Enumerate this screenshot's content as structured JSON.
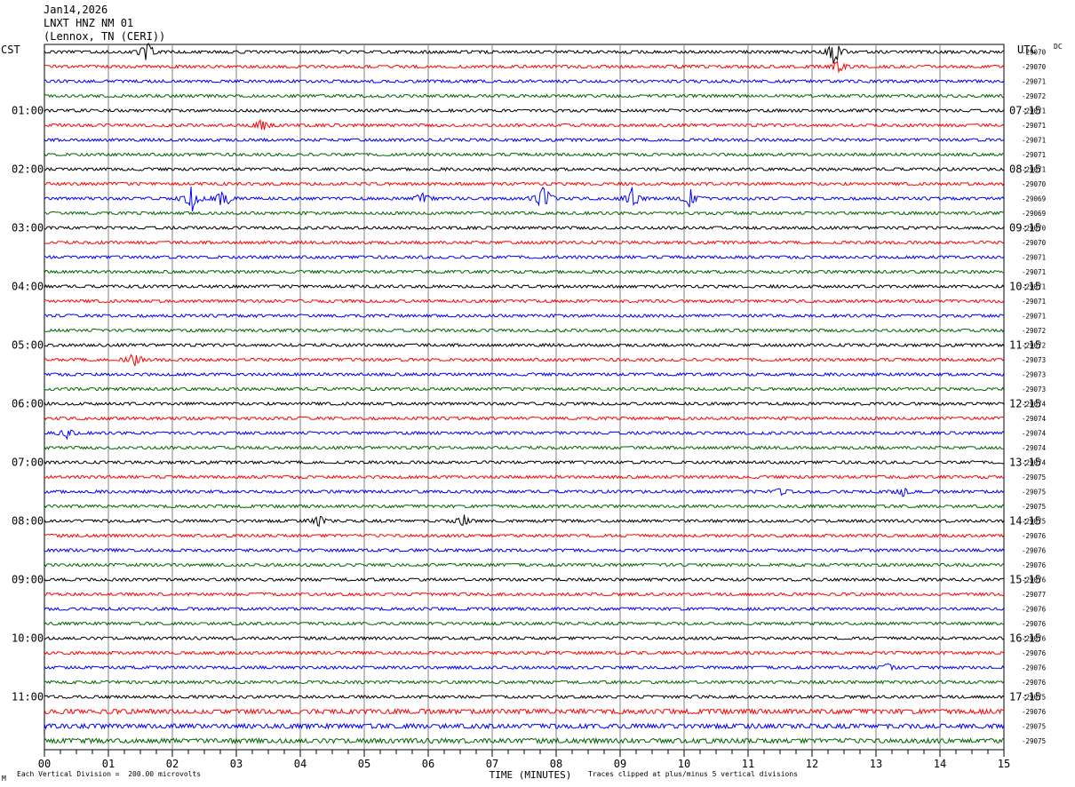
{
  "header": {
    "date": "Jan14,2026",
    "station": "LNXT HNZ NM 01",
    "location": "(Lennox, TN (CERI))"
  },
  "left_tz": "CST",
  "right_tz": "UTC",
  "dc_label": "DC",
  "footer": {
    "scale": "Each Vertical Division =  200.00 microvolts",
    "clip": "Traces clipped at plus/minus 5 vertical divisions",
    "corner": "M"
  },
  "chart_data": {
    "type": "line",
    "xlabel": "TIME (MINUTES)",
    "xlim": [
      0,
      15
    ],
    "x_ticks": [
      "00",
      "01",
      "02",
      "03",
      "04",
      "05",
      "06",
      "07",
      "08",
      "09",
      "10",
      "11",
      "12",
      "13",
      "14",
      "15"
    ],
    "trace_colors": [
      "#000000",
      "#ff0000",
      "#0000ff",
      "#006400"
    ],
    "left_hour_labels": [
      "01:00",
      "02:00",
      "03:00",
      "04:00",
      "05:00",
      "06:00",
      "07:00",
      "08:00",
      "09:00",
      "10:00",
      "11:00"
    ],
    "right_hour_labels": [
      "07:15",
      "08:15",
      "09:15",
      "10:15",
      "11:15",
      "12:15",
      "13:15",
      "14:15",
      "15:15",
      "16:15",
      "17:15"
    ],
    "dc_offsets": [
      "-29070",
      "-29070",
      "-29071",
      "-29072",
      "-29071",
      "-29071",
      "-29071",
      "-29071",
      "-29071",
      "-29070",
      "-29069",
      "-29069",
      "-29070",
      "-29070",
      "-29071",
      "-29071",
      "-29071",
      "-29071",
      "-29071",
      "-29072",
      "-29072",
      "-29073",
      "-29073",
      "-29073",
      "-29074",
      "-29074",
      "-29074",
      "-29074",
      "-29074",
      "-29075",
      "-29075",
      "-29075",
      "-29075",
      "-29076",
      "-29076",
      "-29076",
      "-29076",
      "-29077",
      "-29076",
      "-29076",
      "-29076",
      "-29076",
      "-29076",
      "-29076",
      "-29075",
      "-29076",
      "-29075",
      "-29075"
    ],
    "events": [
      {
        "trace": 0,
        "minute": 1.6,
        "amp": 1.1
      },
      {
        "trace": 0,
        "minute": 12.35,
        "amp": 1.5
      },
      {
        "trace": 1,
        "minute": 12.4,
        "amp": 0.6
      },
      {
        "trace": 5,
        "minute": 3.4,
        "amp": 0.7
      },
      {
        "trace": 10,
        "minute": 2.3,
        "amp": 1.4
      },
      {
        "trace": 10,
        "minute": 2.8,
        "amp": 1.2
      },
      {
        "trace": 10,
        "minute": 5.9,
        "amp": 0.7
      },
      {
        "trace": 10,
        "minute": 7.8,
        "amp": 2.0
      },
      {
        "trace": 10,
        "minute": 9.2,
        "amp": 1.2
      },
      {
        "trace": 10,
        "minute": 10.1,
        "amp": 1.0
      },
      {
        "trace": 21,
        "minute": 1.4,
        "amp": 0.8
      },
      {
        "trace": 26,
        "minute": 0.35,
        "amp": 0.5
      },
      {
        "trace": 30,
        "minute": 11.5,
        "amp": 0.4
      },
      {
        "trace": 30,
        "minute": 13.4,
        "amp": 0.5
      },
      {
        "trace": 32,
        "minute": 4.3,
        "amp": 0.6
      },
      {
        "trace": 32,
        "minute": 6.55,
        "amp": 0.6
      },
      {
        "trace": 42,
        "minute": 13.2,
        "amp": 0.5
      }
    ]
  }
}
